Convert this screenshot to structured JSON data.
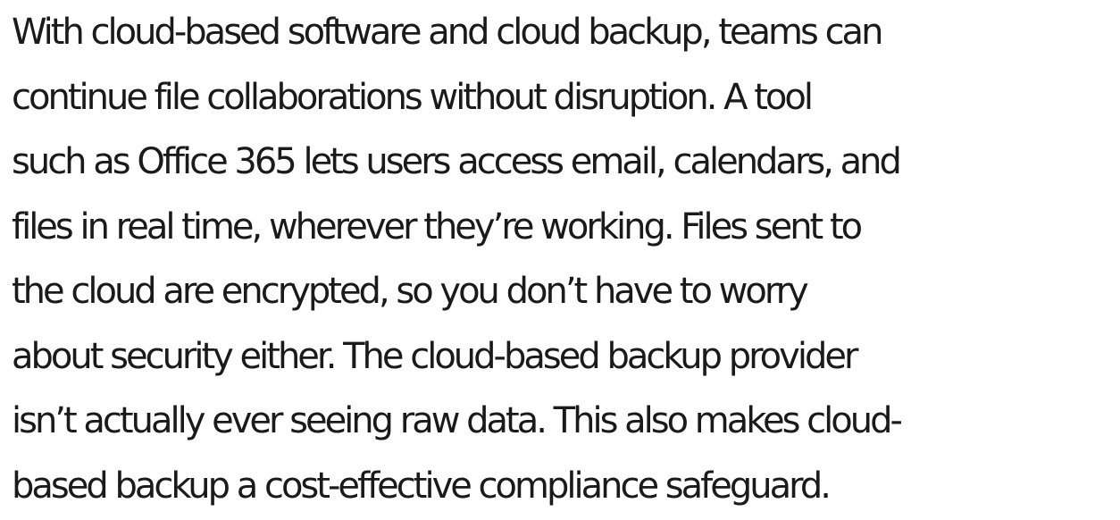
{
  "paragraph": {
    "lines": [
      "With cloud-based software and cloud backup, teams can",
      "continue file collaborations without disruption. A tool",
      "such as Office 365 lets users access email, calendars, and",
      "files in real time, wherever they’re working. Files sent to",
      "the cloud are encrypted, so you don’t have to worry",
      "about security either. The cloud-based backup provider",
      "isn’t actually ever seeing raw data. This also makes cloud-",
      "based backup a cost-effective compliance safeguard."
    ]
  }
}
